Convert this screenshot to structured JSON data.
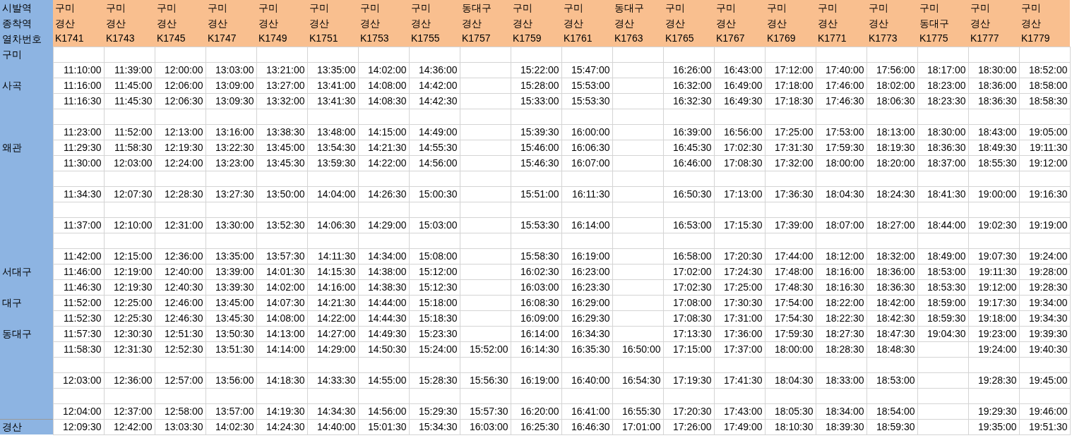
{
  "table": {
    "header_labels": [
      "시발역",
      "종착역",
      "열차번호"
    ],
    "rows": [
      {
        "station": "구미",
        "kind": "blank"
      },
      {
        "kind": "stop"
      },
      {
        "station": "사곡",
        "kind": "stop"
      },
      {
        "kind": "stop"
      },
      {
        "kind": "blank"
      },
      {
        "kind": "stop"
      },
      {
        "station": "왜관",
        "kind": "stop"
      },
      {
        "kind": "stop"
      },
      {
        "kind": "blank"
      },
      {
        "kind": "stop"
      },
      {
        "kind": "blank"
      },
      {
        "kind": "stop"
      },
      {
        "kind": "blank"
      },
      {
        "kind": "stop"
      },
      {
        "station": "서대구",
        "kind": "stop"
      },
      {
        "kind": "stop"
      },
      {
        "station": "대구",
        "kind": "stop"
      },
      {
        "kind": "stop"
      },
      {
        "station": "동대구",
        "kind": "stop"
      },
      {
        "kind": "stop"
      },
      {
        "kind": "blank"
      },
      {
        "kind": "stop"
      },
      {
        "kind": "blank"
      },
      {
        "kind": "stop"
      },
      {
        "station": "경산",
        "kind": "stop"
      }
    ],
    "trains": [
      {
        "origin": "구미",
        "destination": "경산",
        "number": "K1741",
        "kind": "full",
        "times": [
          "11:10:00",
          "11:16:00",
          "11:16:30",
          "11:23:00",
          "11:29:30",
          "11:30:00",
          "11:34:30",
          "11:37:00",
          "11:42:00",
          "11:46:00",
          "11:46:30",
          "11:52:00",
          "11:52:30",
          "11:57:30",
          "11:58:30",
          "12:03:00",
          "12:04:00",
          "12:09:30"
        ]
      },
      {
        "origin": "구미",
        "destination": "경산",
        "number": "K1743",
        "kind": "full",
        "times": [
          "11:39:00",
          "11:45:00",
          "11:45:30",
          "11:52:00",
          "11:58:30",
          "12:03:00",
          "12:07:30",
          "12:10:00",
          "12:15:00",
          "12:19:00",
          "12:19:30",
          "12:25:00",
          "12:25:30",
          "12:30:30",
          "12:31:30",
          "12:36:00",
          "12:37:00",
          "12:42:00"
        ]
      },
      {
        "origin": "구미",
        "destination": "경산",
        "number": "K1745",
        "kind": "full",
        "times": [
          "12:00:00",
          "12:06:00",
          "12:06:30",
          "12:13:00",
          "12:19:30",
          "12:24:00",
          "12:28:30",
          "12:31:00",
          "12:36:00",
          "12:40:00",
          "12:40:30",
          "12:46:00",
          "12:46:30",
          "12:51:30",
          "12:52:30",
          "12:57:00",
          "12:58:00",
          "13:03:30"
        ]
      },
      {
        "origin": "구미",
        "destination": "경산",
        "number": "K1747",
        "kind": "full",
        "times": [
          "13:03:00",
          "13:09:00",
          "13:09:30",
          "13:16:00",
          "13:22:30",
          "13:23:00",
          "13:27:30",
          "13:30:00",
          "13:35:00",
          "13:39:00",
          "13:39:30",
          "13:45:00",
          "13:45:30",
          "13:50:30",
          "13:51:30",
          "13:56:00",
          "13:57:00",
          "14:02:30"
        ]
      },
      {
        "origin": "구미",
        "destination": "경산",
        "number": "K1749",
        "kind": "full",
        "times": [
          "13:21:00",
          "13:27:00",
          "13:32:00",
          "13:38:30",
          "13:45:00",
          "13:45:30",
          "13:50:00",
          "13:52:30",
          "13:57:30",
          "14:01:30",
          "14:02:00",
          "14:07:30",
          "14:08:00",
          "14:13:00",
          "14:14:00",
          "14:18:30",
          "14:19:30",
          "14:24:30"
        ]
      },
      {
        "origin": "구미",
        "destination": "경산",
        "number": "K1751",
        "kind": "full",
        "times": [
          "13:35:00",
          "13:41:00",
          "13:41:30",
          "13:48:00",
          "13:54:30",
          "13:59:30",
          "14:04:00",
          "14:06:30",
          "14:11:30",
          "14:15:30",
          "14:16:00",
          "14:21:30",
          "14:22:00",
          "14:27:00",
          "14:29:00",
          "14:33:30",
          "14:34:30",
          "14:40:00"
        ]
      },
      {
        "origin": "구미",
        "destination": "경산",
        "number": "K1753",
        "kind": "full",
        "times": [
          "14:02:00",
          "14:08:00",
          "14:08:30",
          "14:15:00",
          "14:21:30",
          "14:22:00",
          "14:26:30",
          "14:29:00",
          "14:34:00",
          "14:38:00",
          "14:38:30",
          "14:44:00",
          "14:44:30",
          "14:49:30",
          "14:50:30",
          "14:55:00",
          "14:56:00",
          "15:01:30"
        ]
      },
      {
        "origin": "구미",
        "destination": "경산",
        "number": "K1755",
        "kind": "full",
        "times": [
          "14:36:00",
          "14:42:00",
          "14:42:30",
          "14:49:00",
          "14:55:30",
          "14:56:00",
          "15:00:30",
          "15:03:00",
          "15:08:00",
          "15:12:00",
          "15:12:30",
          "15:18:00",
          "15:18:30",
          "15:23:30",
          "15:24:00",
          "15:28:30",
          "15:29:30",
          "15:34:30"
        ]
      },
      {
        "origin": "동대구",
        "destination": "경산",
        "number": "K1757",
        "kind": "tail",
        "times": [
          "15:52:00",
          "15:56:30",
          "15:57:30",
          "16:03:00"
        ]
      },
      {
        "origin": "구미",
        "destination": "경산",
        "number": "K1759",
        "kind": "full",
        "times": [
          "15:22:00",
          "15:28:00",
          "15:33:00",
          "15:39:30",
          "15:46:00",
          "15:46:30",
          "15:51:00",
          "15:53:30",
          "15:58:30",
          "16:02:30",
          "16:03:00",
          "16:08:30",
          "16:09:00",
          "16:14:00",
          "16:14:30",
          "16:19:00",
          "16:20:00",
          "16:25:30"
        ]
      },
      {
        "origin": "구미",
        "destination": "경산",
        "number": "K1761",
        "kind": "full",
        "times": [
          "15:47:00",
          "15:53:00",
          "15:53:30",
          "16:00:00",
          "16:06:30",
          "16:07:00",
          "16:11:30",
          "16:14:00",
          "16:19:00",
          "16:23:00",
          "16:23:30",
          "16:29:00",
          "16:29:30",
          "16:34:30",
          "16:35:30",
          "16:40:00",
          "16:41:00",
          "16:46:30"
        ]
      },
      {
        "origin": "동대구",
        "destination": "경산",
        "number": "K1763",
        "kind": "tail",
        "times": [
          "16:50:00",
          "16:54:30",
          "16:55:30",
          "17:01:00"
        ]
      },
      {
        "origin": "구미",
        "destination": "경산",
        "number": "K1765",
        "kind": "full",
        "times": [
          "16:26:00",
          "16:32:00",
          "16:32:30",
          "16:39:00",
          "16:45:30",
          "16:46:00",
          "16:50:30",
          "16:53:00",
          "16:58:00",
          "17:02:00",
          "17:02:30",
          "17:08:00",
          "17:08:30",
          "17:13:30",
          "17:15:00",
          "17:19:30",
          "17:20:30",
          "17:26:00"
        ]
      },
      {
        "origin": "구미",
        "destination": "경산",
        "number": "K1767",
        "kind": "full",
        "times": [
          "16:43:00",
          "16:49:00",
          "16:49:30",
          "16:56:00",
          "17:02:30",
          "17:08:30",
          "17:13:00",
          "17:15:30",
          "17:20:30",
          "17:24:30",
          "17:25:00",
          "17:30:30",
          "17:31:00",
          "17:36:00",
          "17:37:00",
          "17:41:30",
          "17:43:00",
          "17:49:00"
        ]
      },
      {
        "origin": "구미",
        "destination": "경산",
        "number": "K1769",
        "kind": "full",
        "times": [
          "17:12:00",
          "17:18:00",
          "17:18:30",
          "17:25:00",
          "17:31:30",
          "17:32:00",
          "17:36:30",
          "17:39:00",
          "17:44:00",
          "17:48:00",
          "17:48:30",
          "17:54:00",
          "17:54:30",
          "17:59:30",
          "18:00:00",
          "18:04:30",
          "18:05:30",
          "18:10:30"
        ]
      },
      {
        "origin": "구미",
        "destination": "경산",
        "number": "K1771",
        "kind": "full",
        "times": [
          "17:40:00",
          "17:46:00",
          "17:46:30",
          "17:53:00",
          "17:59:30",
          "18:00:00",
          "18:04:30",
          "18:07:00",
          "18:12:00",
          "18:16:00",
          "18:16:30",
          "18:22:00",
          "18:22:30",
          "18:27:30",
          "18:28:30",
          "18:33:00",
          "18:34:00",
          "18:39:30"
        ]
      },
      {
        "origin": "구미",
        "destination": "경산",
        "number": "K1773",
        "kind": "full",
        "times": [
          "17:56:00",
          "18:02:00",
          "18:06:30",
          "18:13:00",
          "18:19:30",
          "18:20:00",
          "18:24:30",
          "18:27:00",
          "18:32:00",
          "18:36:00",
          "18:36:30",
          "18:42:00",
          "18:42:30",
          "18:47:30",
          "18:48:30",
          "18:53:00",
          "18:54:00",
          "18:59:30"
        ]
      },
      {
        "origin": "구미",
        "destination": "동대구",
        "number": "K1775",
        "kind": "head",
        "times": [
          "18:17:00",
          "18:23:00",
          "18:23:30",
          "18:30:00",
          "18:36:30",
          "18:37:00",
          "18:41:30",
          "18:44:00",
          "18:49:00",
          "18:53:00",
          "18:53:30",
          "18:59:00",
          "18:59:30",
          "19:04:30"
        ]
      },
      {
        "origin": "구미",
        "destination": "경산",
        "number": "K1777",
        "kind": "full",
        "times": [
          "18:30:00",
          "18:36:00",
          "18:36:30",
          "18:43:00",
          "18:49:30",
          "18:55:30",
          "19:00:00",
          "19:02:30",
          "19:07:30",
          "19:11:30",
          "19:12:00",
          "19:17:30",
          "19:18:00",
          "19:23:00",
          "19:24:00",
          "19:28:30",
          "19:29:30",
          "19:35:00"
        ]
      },
      {
        "origin": "구미",
        "destination": "경산",
        "number": "K1779",
        "kind": "full",
        "times": [
          "18:52:00",
          "18:58:00",
          "18:58:30",
          "19:05:00",
          "19:11:30",
          "19:12:00",
          "19:16:30",
          "19:19:00",
          "19:24:00",
          "19:28:00",
          "19:28:30",
          "19:34:00",
          "19:34:30",
          "19:39:30",
          "19:40:30",
          "19:45:00",
          "19:46:00",
          "19:51:30"
        ]
      }
    ]
  }
}
